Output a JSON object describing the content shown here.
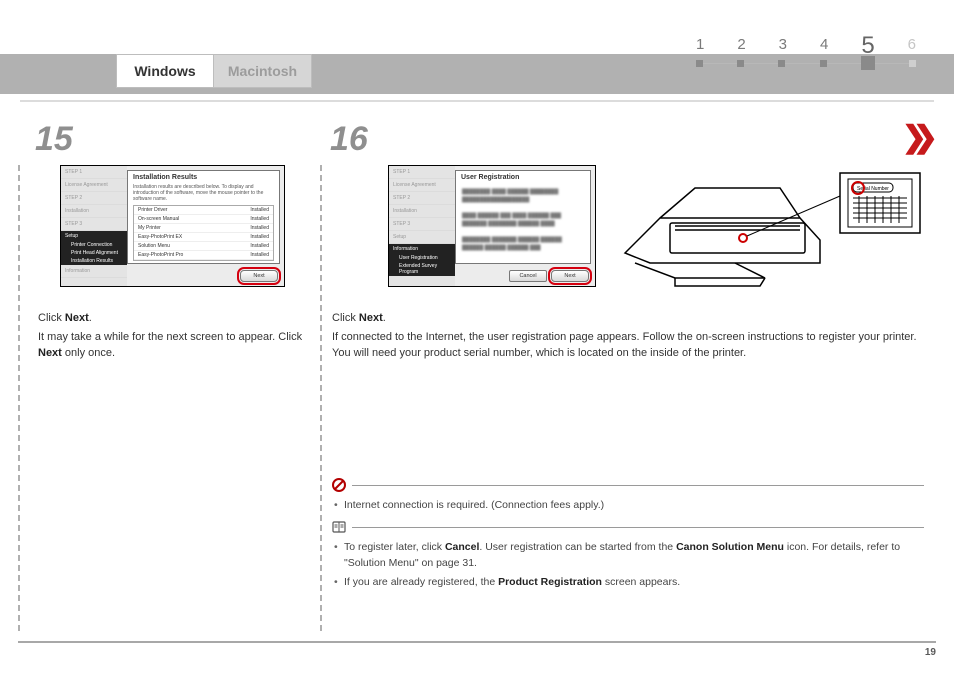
{
  "header": {
    "tabs": {
      "windows": "Windows",
      "macintosh": "Macintosh"
    },
    "steps": [
      "1",
      "2",
      "3",
      "4",
      "5",
      "6"
    ]
  },
  "arrows": "❯❯",
  "step15": {
    "num": "15",
    "panel": {
      "title": "Installation Results",
      "desc": "Installation results are described below. To display and introduction of the software, move the mouse pointer to the software name.",
      "side": {
        "s1": "STEP 1",
        "s1a": "License Agreement",
        "s2": "STEP 2",
        "s2a": "Installation",
        "s3": "STEP 3",
        "grp": "Setup",
        "sub1": "Printer Connection",
        "sub2": "Print Head Alignment",
        "sub3": "Installation Results",
        "inf": "Information"
      },
      "items": [
        {
          "n": "Printer Driver",
          "s": "Installed"
        },
        {
          "n": "On-screen Manual",
          "s": "Installed"
        },
        {
          "n": "My Printer",
          "s": "Installed"
        },
        {
          "n": "Easy-PhotoPrint EX",
          "s": "Installed"
        },
        {
          "n": "Solution Menu",
          "s": "Installed"
        },
        {
          "n": "Easy-PhotoPrint Pro",
          "s": "Installed"
        }
      ],
      "next": "Next"
    },
    "line1_a": "Click ",
    "line1_b": "Next",
    "line1_c": ".",
    "line2_a": "It may take a while for the next screen to appear. Click ",
    "line2_b": "Next",
    "line2_c": " only once."
  },
  "step16": {
    "num": "16",
    "panel": {
      "title": "User Registration",
      "side": {
        "s1": "STEP 1",
        "s1a": "License Agreement",
        "s2": "STEP 2",
        "s2a": "Installation",
        "s3": "STEP 3",
        "s3a": "Setup",
        "grp": "Information",
        "sub1": "User Registration",
        "sub2": "Extended Survey Program"
      },
      "cancel": "Cancel",
      "next": "Next"
    },
    "line1_a": "Click ",
    "line1_b": "Next",
    "line1_c": ".",
    "line2": "If connected to the Internet, the user registration page appears. Follow the on-screen instructions to register your printer. You will need your product serial number, which is located on the inside of the printer."
  },
  "printer_label": "Serial Number",
  "notes": {
    "warn1": "Internet connection is required. (Connection fees apply.)",
    "info1_a": "To register later, click ",
    "info1_b": "Cancel",
    "info1_c": ". User registration can be started from the ",
    "info1_d": "Canon Solution Menu",
    "info1_e": " icon. For details, refer to \"Solution Menu\" on page 31.",
    "info2_a": "If you are already registered, the ",
    "info2_b": "Product Registration",
    "info2_c": " screen appears."
  },
  "page_number": "19"
}
